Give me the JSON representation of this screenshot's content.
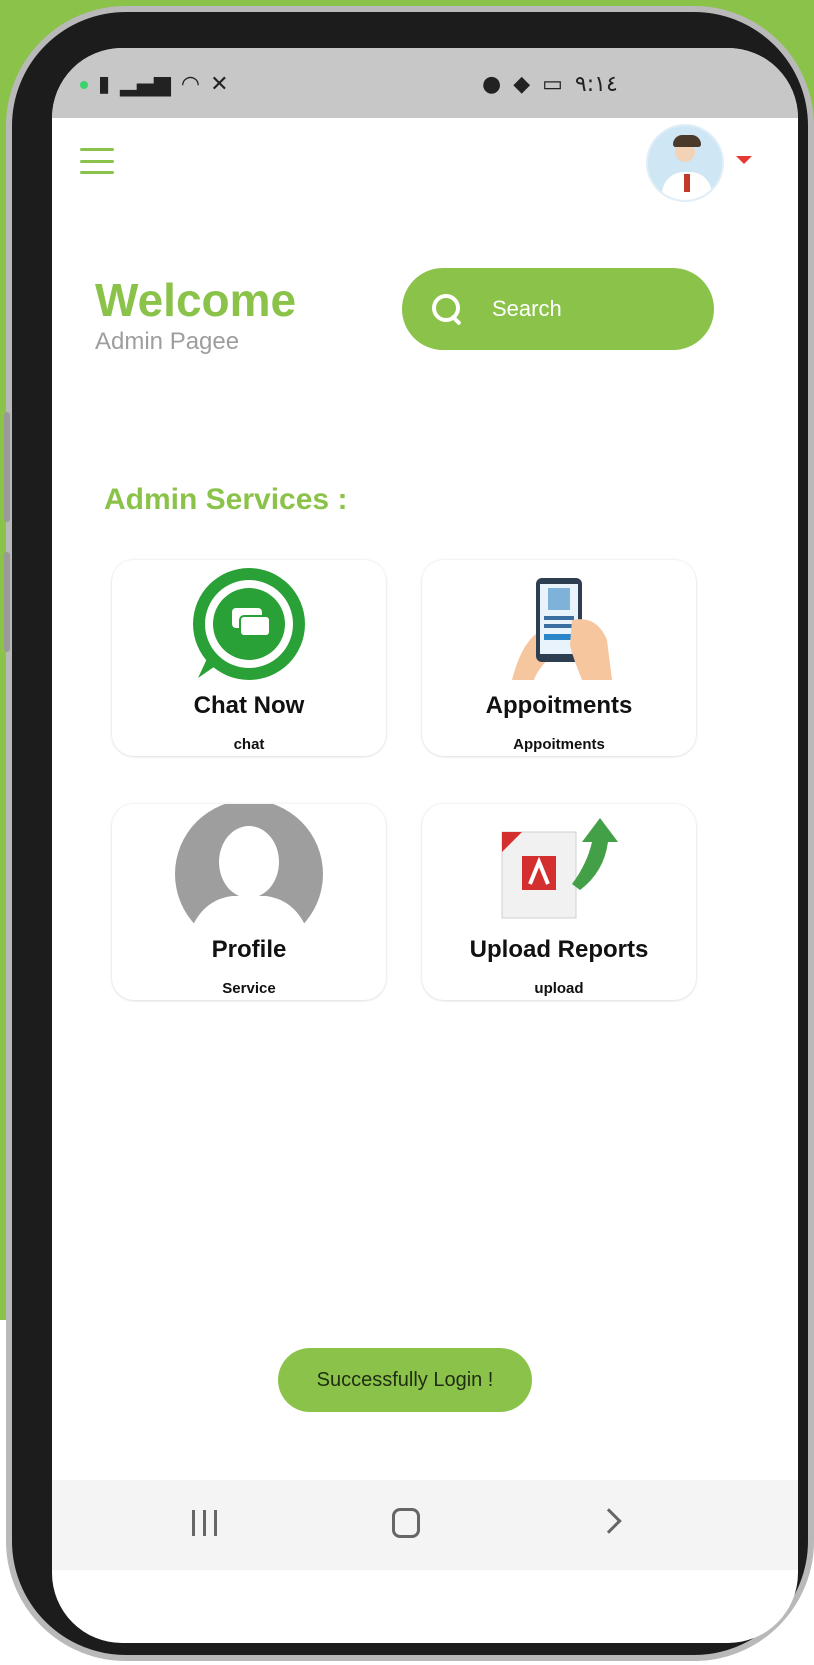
{
  "status_bar": {
    "time": "٩:١٤"
  },
  "header": {
    "menu_icon": "hamburger-icon",
    "avatar": "doctor-avatar"
  },
  "welcome": {
    "title": "Welcome",
    "subtitle": "Admin Pagee"
  },
  "search": {
    "placeholder": "Search",
    "icon": "search-icon"
  },
  "services": {
    "heading": "Admin Services :",
    "items": [
      {
        "title": "Chat Now",
        "subtitle": "chat",
        "icon": "whatsapp-chat-icon"
      },
      {
        "title": "Appoitments",
        "subtitle": "Appoitments",
        "icon": "appointment-phone-icon"
      },
      {
        "title": "Profile",
        "subtitle": "Service",
        "icon": "profile-icon"
      },
      {
        "title": "Upload Reports",
        "subtitle": "upload",
        "icon": "pdf-upload-icon"
      }
    ]
  },
  "toast": {
    "message": "Successfully Login !"
  },
  "colors": {
    "accent": "#8bc34a",
    "caret": "#e53935"
  }
}
